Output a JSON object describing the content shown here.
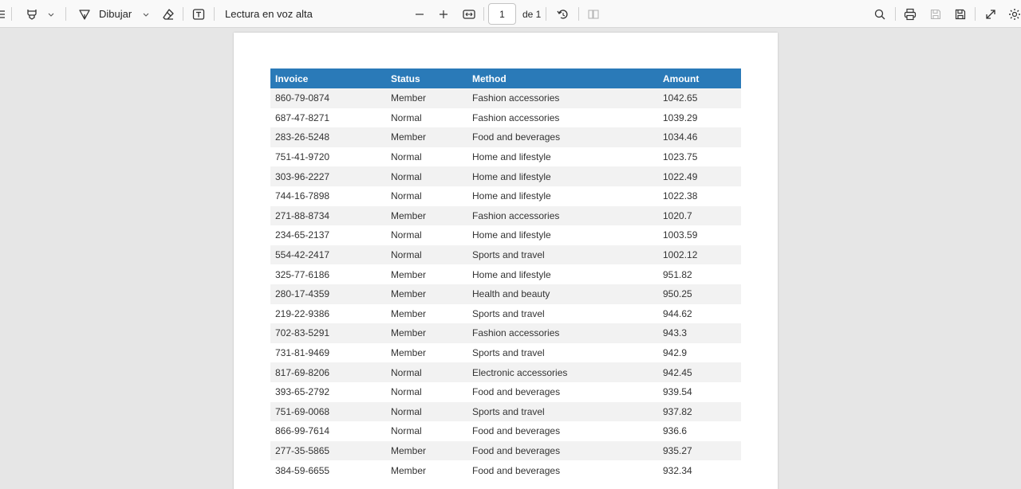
{
  "toolbar": {
    "draw_label": "Dibujar",
    "read_aloud_label": "Lectura en voz alta",
    "page_number": "1",
    "page_total": "de 1"
  },
  "table": {
    "headers": [
      "Invoice",
      "Status",
      "Method",
      "Amount"
    ],
    "rows": [
      [
        "860-79-0874",
        "Member",
        "Fashion accessories",
        "1042.65"
      ],
      [
        "687-47-8271",
        "Normal",
        "Fashion accessories",
        "1039.29"
      ],
      [
        "283-26-5248",
        "Member",
        "Food and beverages",
        "1034.46"
      ],
      [
        "751-41-9720",
        "Normal",
        "Home and lifestyle",
        "1023.75"
      ],
      [
        "303-96-2227",
        "Normal",
        "Home and lifestyle",
        "1022.49"
      ],
      [
        "744-16-7898",
        "Normal",
        "Home and lifestyle",
        "1022.38"
      ],
      [
        "271-88-8734",
        "Member",
        "Fashion accessories",
        "1020.7"
      ],
      [
        "234-65-2137",
        "Normal",
        "Home and lifestyle",
        "1003.59"
      ],
      [
        "554-42-2417",
        "Normal",
        "Sports and travel",
        "1002.12"
      ],
      [
        "325-77-6186",
        "Member",
        "Home and lifestyle",
        "951.82"
      ],
      [
        "280-17-4359",
        "Member",
        "Health and beauty",
        "950.25"
      ],
      [
        "219-22-9386",
        "Member",
        "Sports and travel",
        "944.62"
      ],
      [
        "702-83-5291",
        "Member",
        "Fashion accessories",
        "943.3"
      ],
      [
        "731-81-9469",
        "Member",
        "Sports and travel",
        "942.9"
      ],
      [
        "817-69-8206",
        "Normal",
        "Electronic accessories",
        "942.45"
      ],
      [
        "393-65-2792",
        "Normal",
        "Food and beverages",
        "939.54"
      ],
      [
        "751-69-0068",
        "Normal",
        "Sports and travel",
        "937.82"
      ],
      [
        "866-99-7614",
        "Normal",
        "Food and beverages",
        "936.6"
      ],
      [
        "277-35-5865",
        "Member",
        "Food and beverages",
        "935.27"
      ],
      [
        "384-59-6655",
        "Member",
        "Food and beverages",
        "932.34"
      ]
    ]
  },
  "colors": {
    "header_bg": "#2a7ab8",
    "header_text": "#ffffff",
    "stripe": "#f2f2f2",
    "viewer_bg": "#e6e6e6"
  }
}
